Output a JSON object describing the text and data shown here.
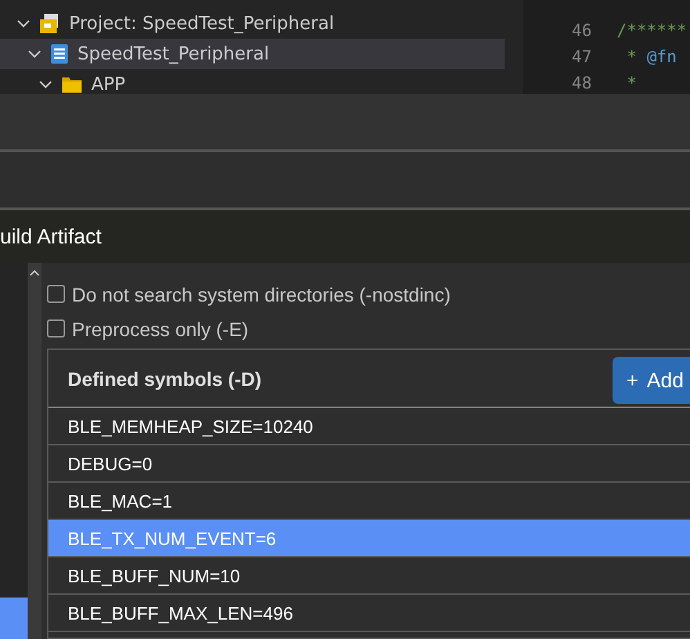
{
  "explorer": {
    "tree": [
      {
        "label": "Project: SpeedTest_Peripheral",
        "kind": "project",
        "expanded": true,
        "selected": false,
        "children": [
          {
            "label": "SpeedTest_Peripheral",
            "kind": "target",
            "expanded": true,
            "selected": true,
            "children": [
              {
                "label": "APP",
                "kind": "folder",
                "expanded": true,
                "selected": false
              }
            ]
          }
        ]
      }
    ]
  },
  "editor": {
    "lines": [
      {
        "number": "46",
        "parts": [
          {
            "kind": "comment",
            "text": "/******"
          }
        ]
      },
      {
        "number": "47",
        "parts": [
          {
            "kind": "comment",
            "text": " * "
          },
          {
            "kind": "tag",
            "text": "@fn"
          }
        ]
      },
      {
        "number": "48",
        "parts": [
          {
            "kind": "comment",
            "text": " *"
          }
        ]
      }
    ]
  },
  "dialog": {
    "title": "uild Artifact",
    "sidebar": {
      "items": [
        {
          "selected": true
        }
      ]
    },
    "options": [
      {
        "label": "Do not search system directories (-nostdinc)",
        "checked": false
      },
      {
        "label": "Preprocess only (-E)",
        "checked": false
      }
    ],
    "symbols": {
      "heading": "Defined symbols (-D)",
      "add_button": {
        "icon": "+",
        "label": "Add"
      },
      "rows": [
        {
          "text": "BLE_MEMHEAP_SIZE=10240",
          "selected": false
        },
        {
          "text": "DEBUG=0",
          "selected": false
        },
        {
          "text": "BLE_MAC=1",
          "selected": false
        },
        {
          "text": "BLE_TX_NUM_EVENT=6",
          "selected": true
        },
        {
          "text": "BLE_BUFF_NUM=10",
          "selected": false
        },
        {
          "text": "BLE_BUFF_MAX_LEN=496",
          "selected": false
        }
      ]
    }
  }
}
